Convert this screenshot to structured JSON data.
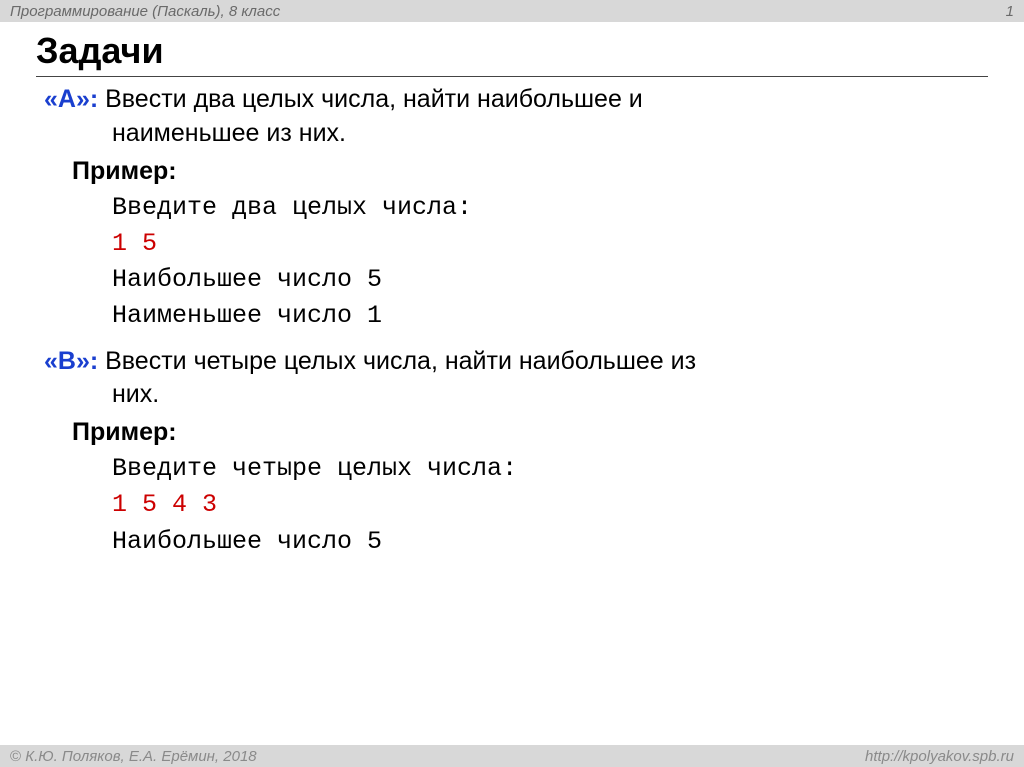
{
  "header": {
    "left": "Программирование (Паскаль), 8 класс",
    "right": "1"
  },
  "title": "Задачи",
  "tasks": [
    {
      "label": "«A»:",
      "text_first": " Ввести два целых числа, найти наибольшее и",
      "text_cont": "наименьшее из них.",
      "example_label": "Пример:",
      "lines": [
        {
          "text": "Введите два целых числа:",
          "color": "black"
        },
        {
          "text": "1 5",
          "color": "red"
        },
        {
          "text": "Наибольшее число 5",
          "color": "black"
        },
        {
          "text": "Наименьшее число 1",
          "color": "black"
        }
      ]
    },
    {
      "label": "«B»:",
      "text_first": " Ввести четыре целых числа, найти наибольшее из",
      "text_cont": "них.",
      "example_label": "Пример:",
      "lines": [
        {
          "text": "Введите четыре целых числа:",
          "color": "black"
        },
        {
          "text": "1 5 4 3",
          "color": "red"
        },
        {
          "text": "Наибольшее число 5",
          "color": "black"
        }
      ]
    }
  ],
  "footer": {
    "copyright_symbol": "©",
    "left_text": " К.Ю. Поляков, Е.А. Ерёмин, 2018",
    "right": "http://kpolyakov.spb.ru"
  }
}
